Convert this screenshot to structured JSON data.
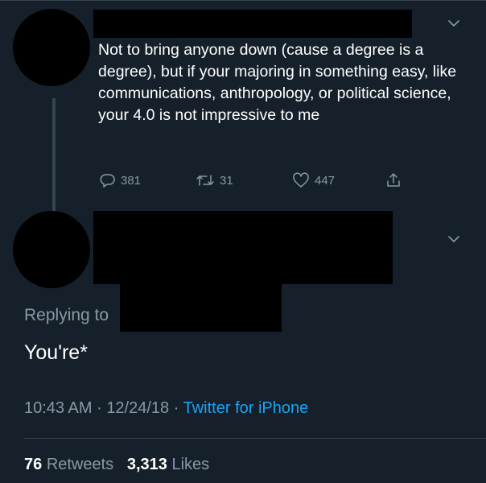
{
  "first_tweet": {
    "text": "Not to bring anyone down (cause a degree is a degree), but if your majoring in something easy, like communications, anthropology,  or political science, your 4.0 is not impressive to me",
    "replies": "381",
    "retweets": "31",
    "likes": "447",
    "icons": [
      "reply-icon",
      "retweet-icon",
      "heart-icon",
      "share-icon",
      "chevron-down-icon"
    ]
  },
  "reply_tweet": {
    "replying_to_label": "Replying to",
    "text": "You're*",
    "time": "10:43 AM",
    "date": "12/24/18",
    "separator": "·",
    "source": "Twitter for iPhone",
    "retweets_count": "76",
    "retweets_label": "Retweets",
    "likes_count": "3,313",
    "likes_label": "Likes"
  },
  "colors": {
    "background": "#15202b",
    "muted": "#8899a6",
    "link": "#1da1f2",
    "divider": "#38444d"
  }
}
